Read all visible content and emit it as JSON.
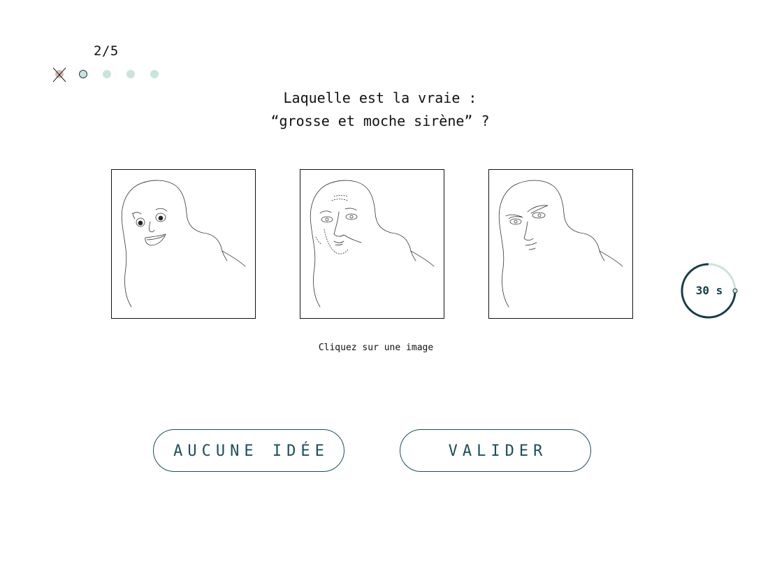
{
  "progress": {
    "counter": "2/5",
    "steps": [
      "failed",
      "current",
      "pending",
      "pending",
      "pending"
    ]
  },
  "question": {
    "line1": "Laquelle est la vraie :",
    "line2": "“grosse et moche sirène” ?"
  },
  "choices": [
    {
      "icon": "cartoon-face-drawing"
    },
    {
      "icon": "old-man-face-drawing"
    },
    {
      "icon": "skeptical-face-drawing"
    }
  ],
  "hint": "Cliquez sur une image",
  "timer": {
    "label": "30 s",
    "remaining_fraction": 0.75
  },
  "buttons": {
    "no_idea": "AUCUNE IDÉE",
    "validate": "VALIDER"
  },
  "colors": {
    "accent": "#1c4f59",
    "timer_track": "#c9e4dc",
    "dot_pending": "#c9e4dc",
    "dot_failed": "#d9bdb8"
  }
}
